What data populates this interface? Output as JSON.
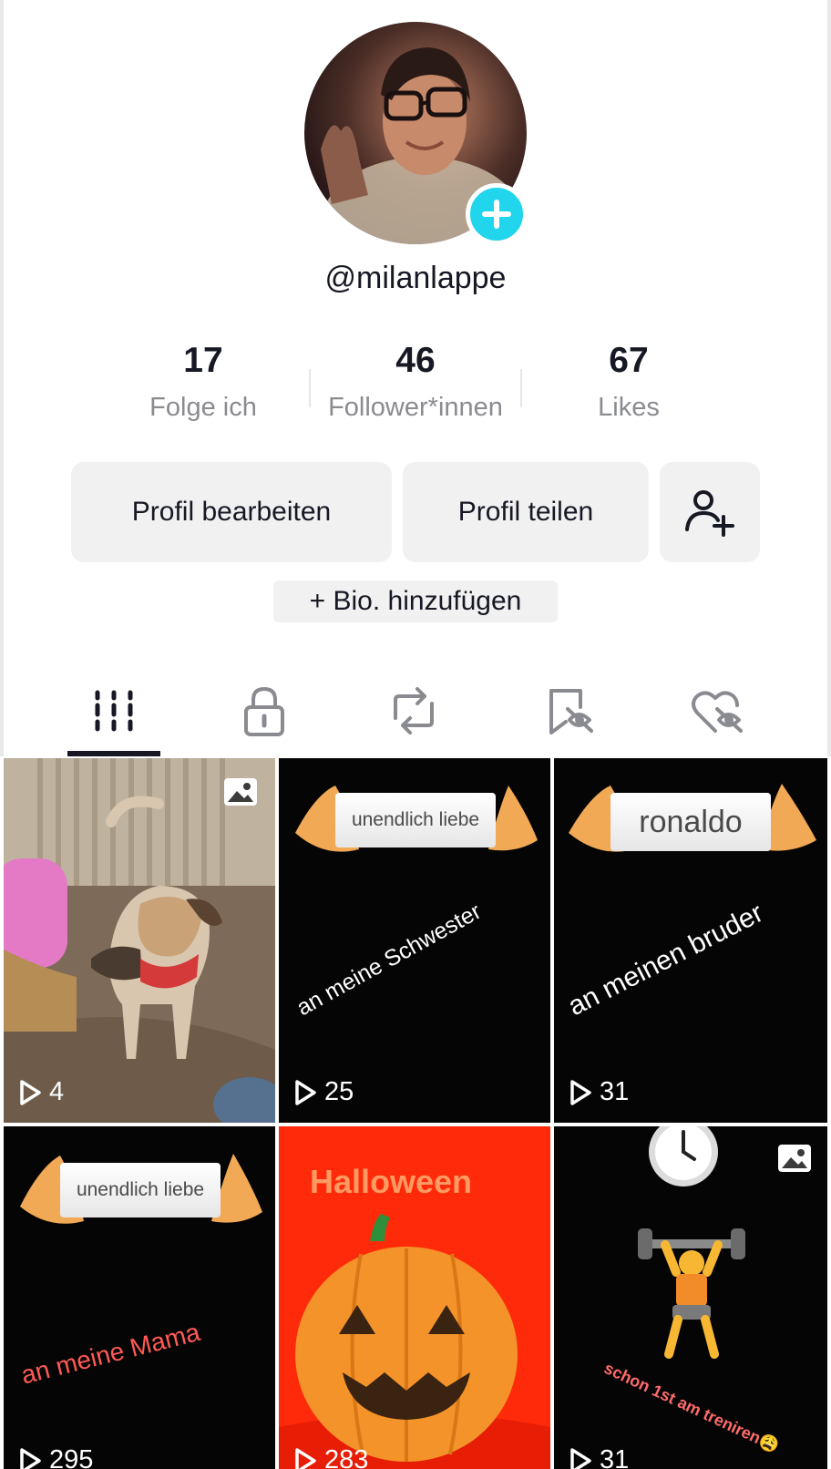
{
  "profile": {
    "username": "@milanlappe",
    "stats": [
      {
        "value": "17",
        "label": "Folge ich"
      },
      {
        "value": "46",
        "label": "Follower*innen"
      },
      {
        "value": "67",
        "label": "Likes"
      }
    ],
    "buttons": {
      "edit": "Profil bearbeiten",
      "share": "Profil teilen"
    },
    "bio": "+ Bio. hinzufügen"
  },
  "tabs": [
    "videos-grid-icon",
    "lock-icon",
    "repost-icon",
    "bookmark-icon",
    "liked-icon"
  ],
  "colors": {
    "accent": "#20d5ec",
    "text": "#161823",
    "muted": "#8a8b91",
    "button_bg": "#f1f1f2",
    "halloween_bg": "#ff2a0a",
    "halloween_text": "#ff9a62",
    "mama_text": "#ff5a55"
  },
  "videos": [
    {
      "views": "4",
      "photo": true
    },
    {
      "views": "25",
      "slip": "unendlich liebe",
      "caption": "an meine Schwester"
    },
    {
      "views": "31",
      "slip": "ronaldo",
      "caption": "an meinen bruder"
    },
    {
      "views": "295",
      "slip": "unendlich liebe",
      "caption": "an meine Mama"
    },
    {
      "views": "283",
      "title": "Halloween"
    },
    {
      "views": "31",
      "photo": true,
      "caption": "schon 1st am treniren😩"
    }
  ]
}
